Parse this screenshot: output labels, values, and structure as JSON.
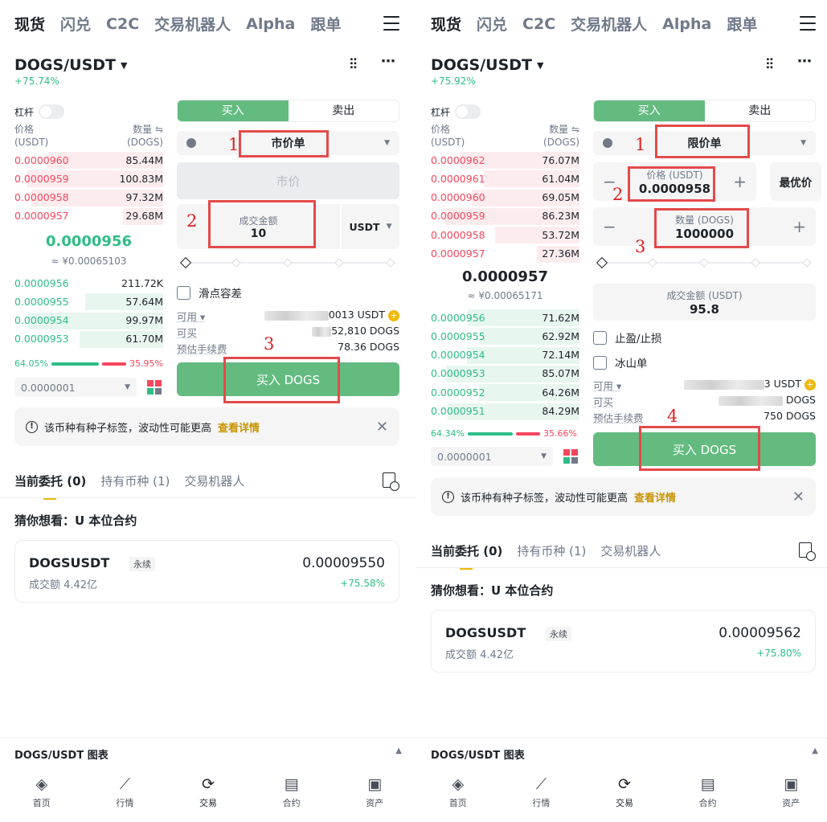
{
  "nav_tabs": [
    "现货",
    "闪兑",
    "C2C",
    "交易机器人",
    "Alpha",
    "跟单"
  ],
  "pair": "DOGS/USDT",
  "leverage_label": "杠杆",
  "ob_header": {
    "price": "价格",
    "price_unit": "(USDT)",
    "qty": "数量 ⇋",
    "qty_unit": "(DOGS)"
  },
  "buy_label": "买入",
  "sell_label": "卖出",
  "notice": {
    "text": "该币种有种子标签，波动性可能更高",
    "link": "查看详情"
  },
  "bottom_tabs": [
    "当前委托 (0)",
    "持有币种 (1)",
    "交易机器人"
  ],
  "guess_title": "猜你想看：U 本位合约",
  "card": {
    "symbol": "DOGSUSDT",
    "tag": "永续",
    "volume": "成交额 4.42亿"
  },
  "chart_label": "DOGS/USDT 图表",
  "bottom_nav": [
    "首页",
    "行情",
    "交易",
    "合约",
    "资产"
  ],
  "left": {
    "change": "+75.74%",
    "asks": [
      [
        "0.0000960",
        "85.44M"
      ],
      [
        "0.0000959",
        "100.83M"
      ],
      [
        "0.0000958",
        "97.32M"
      ],
      [
        "0.0000957",
        "29.68M"
      ]
    ],
    "mid_price": "0.0000956",
    "mid_fiat": "≈ ¥0.00065103",
    "bids": [
      [
        "0.0000956",
        "211.72K"
      ],
      [
        "0.0000955",
        "57.64M"
      ],
      [
        "0.0000954",
        "99.97M"
      ],
      [
        "0.0000953",
        "61.70M"
      ]
    ],
    "ratio_buy": "64.05%",
    "ratio_sell": "35.95%",
    "precision": "0.0000001",
    "order_type": "市价单",
    "market_text": "市价",
    "amount_label": "成交金额",
    "amount_value": "10",
    "amount_unit": "USDT",
    "slippage_label": "滑点容差",
    "available_label": "可用",
    "available_value": "0013 USDT",
    "can_buy_label": "可买",
    "can_buy_value": "52,810 DOGS",
    "fee_label": "预估手续费",
    "fee_value": "78.36 DOGS",
    "buy_button": "买入 DOGS",
    "card_price": "0.00009550",
    "card_change": "+75.58%",
    "annotations": [
      "1",
      "2",
      "3"
    ]
  },
  "right": {
    "change": "+75.92%",
    "asks": [
      [
        "0.0000962",
        "76.07M"
      ],
      [
        "0.0000961",
        "61.04M"
      ],
      [
        "0.0000960",
        "69.05M"
      ],
      [
        "0.0000959",
        "86.23M"
      ],
      [
        "0.0000958",
        "53.72M"
      ],
      [
        "0.0000957",
        "27.36M"
      ]
    ],
    "mid_price": "0.0000957",
    "mid_fiat": "≈ ¥0.00065171",
    "bids": [
      [
        "0.0000956",
        "71.62M"
      ],
      [
        "0.0000955",
        "62.92M"
      ],
      [
        "0.0000954",
        "72.14M"
      ],
      [
        "0.0000953",
        "85.07M"
      ],
      [
        "0.0000952",
        "64.26M"
      ],
      [
        "0.0000951",
        "84.29M"
      ]
    ],
    "ratio_buy": "64.34%",
    "ratio_sell": "35.66%",
    "precision": "0.0000001",
    "order_type": "限价单",
    "price_label": "价格 (USDT)",
    "price_value": "0.0000958",
    "best_price": "最优价",
    "qty_label": "数量 (DOGS)",
    "qty_value": "1000000",
    "total_label": "成交金额 (USDT)",
    "total_value": "95.8",
    "tpsl_label": "止盈/止损",
    "iceberg_label": "冰山单",
    "available_label": "可用",
    "available_value": "3 USDT",
    "can_buy_label": "可买",
    "can_buy_value": "DOGS",
    "fee_label": "预估手续费",
    "fee_value": "750 DOGS",
    "buy_button": "买入 DOGS",
    "card_price": "0.00009562",
    "card_change": "+75.80%",
    "annotations": [
      "1",
      "2",
      "3",
      "4"
    ]
  }
}
